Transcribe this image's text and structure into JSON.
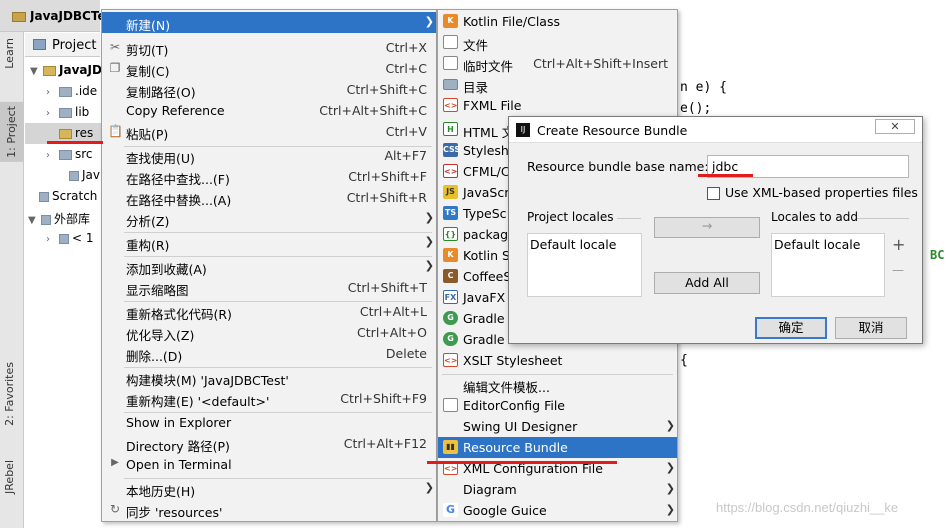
{
  "window": {
    "title": "JavaJDBCTe"
  },
  "left_tabs": [
    "Learn",
    "1: Project",
    "2: Favorites",
    "JRebel"
  ],
  "project_toolbar": {
    "label": "Project"
  },
  "project_tree": [
    {
      "label": "JavaJD",
      "arrow": "▼"
    },
    {
      "label": ".ide",
      "arrow": "›"
    },
    {
      "label": "lib",
      "arrow": "›"
    },
    {
      "label": "res",
      "arrow": ""
    },
    {
      "label": "src",
      "arrow": "›"
    },
    {
      "label": "Jav",
      "arrow": ""
    },
    {
      "label": "Scratch",
      "arrow": ""
    },
    {
      "label": "外部库",
      "arrow": "▼"
    },
    {
      "label": "< 1",
      "arrow": "›"
    }
  ],
  "editor": {
    "lines": [
      "n e) {",
      "e();",
      "{"
    ],
    "highlight_text": "BC"
  },
  "context_menu": {
    "items": [
      {
        "label": "新建(N)",
        "shortcut": "",
        "icon": "",
        "submenu": true,
        "highlighted": true
      },
      {
        "label": "剪切(T)",
        "shortcut": "Ctrl+X",
        "icon": "scissors-icon",
        "submenu": false
      },
      {
        "label": "复制(C)",
        "shortcut": "Ctrl+C",
        "icon": "copy-icon",
        "submenu": false
      },
      {
        "label": "复制路径(O)",
        "shortcut": "Ctrl+Shift+C",
        "icon": "",
        "submenu": false
      },
      {
        "label": "Copy Reference",
        "shortcut": "Ctrl+Alt+Shift+C",
        "icon": "",
        "submenu": false
      },
      {
        "label": "粘贴(P)",
        "shortcut": "Ctrl+V",
        "icon": "paste-icon",
        "submenu": false
      },
      {
        "label": "查找使用(U)",
        "shortcut": "Alt+F7",
        "icon": "",
        "submenu": false
      },
      {
        "label": "在路径中查找...(F)",
        "shortcut": "Ctrl+Shift+F",
        "icon": "",
        "submenu": false
      },
      {
        "label": "在路径中替换...(A)",
        "shortcut": "Ctrl+Shift+R",
        "icon": "",
        "submenu": false
      },
      {
        "label": "分析(Z)",
        "shortcut": "",
        "icon": "",
        "submenu": true
      },
      {
        "label": "重构(R)",
        "shortcut": "",
        "icon": "",
        "submenu": true
      },
      {
        "label": "添加到收藏(A)",
        "shortcut": "",
        "icon": "",
        "submenu": true
      },
      {
        "label": "显示缩略图",
        "shortcut": "Ctrl+Shift+T",
        "icon": "",
        "submenu": false
      },
      {
        "label": "重新格式化代码(R)",
        "shortcut": "Ctrl+Alt+L",
        "icon": "",
        "submenu": false
      },
      {
        "label": "优化导入(Z)",
        "shortcut": "Ctrl+Alt+O",
        "icon": "",
        "submenu": false
      },
      {
        "label": "删除...(D)",
        "shortcut": "Delete",
        "icon": "",
        "submenu": false
      },
      {
        "label": "构建模块(M) 'JavaJDBCTest'",
        "shortcut": "",
        "icon": "",
        "submenu": false
      },
      {
        "label": "重新构建(E) '<default>'",
        "shortcut": "Ctrl+Shift+F9",
        "icon": "",
        "submenu": false
      },
      {
        "label": "Show in Explorer",
        "shortcut": "",
        "icon": "",
        "submenu": false
      },
      {
        "label": "Directory 路径(P)",
        "shortcut": "Ctrl+Alt+F12",
        "icon": "",
        "submenu": false
      },
      {
        "label": "Open in Terminal",
        "shortcut": "",
        "icon": "terminal-icon",
        "submenu": false
      },
      {
        "label": "本地历史(H)",
        "shortcut": "",
        "icon": "",
        "submenu": true
      },
      {
        "label": "同步 'resources'",
        "shortcut": "",
        "icon": "sync-icon",
        "submenu": false
      }
    ]
  },
  "new_submenu": {
    "items": [
      {
        "label": "Kotlin File/Class",
        "shortcut": "",
        "icon": "kotlin-icon",
        "submenu": false
      },
      {
        "label": "文件",
        "shortcut": "",
        "icon": "file-icon",
        "submenu": false
      },
      {
        "label": "临时文件",
        "shortcut": "Ctrl+Alt+Shift+Insert",
        "icon": "scratch-file-icon",
        "submenu": false
      },
      {
        "label": "目录",
        "shortcut": "",
        "icon": "folder-icon",
        "submenu": false
      },
      {
        "label": "FXML File",
        "shortcut": "",
        "icon": "fxml-icon",
        "submenu": false
      },
      {
        "label": "HTML 文",
        "shortcut": "",
        "icon": "html-icon",
        "submenu": false
      },
      {
        "label": "Styleshe",
        "shortcut": "",
        "icon": "css-icon",
        "submenu": false
      },
      {
        "label": "CFML/C",
        "shortcut": "",
        "icon": "cfml-icon",
        "submenu": false
      },
      {
        "label": "JavaScr",
        "shortcut": "",
        "icon": "javascript-icon",
        "submenu": false
      },
      {
        "label": "TypeSc",
        "shortcut": "",
        "icon": "typescript-icon",
        "submenu": false
      },
      {
        "label": "packag",
        "shortcut": "",
        "icon": "package-json-icon",
        "submenu": false
      },
      {
        "label": "Kotlin S",
        "shortcut": "",
        "icon": "kotlin-script-icon",
        "submenu": false
      },
      {
        "label": "CoffeeS",
        "shortcut": "",
        "icon": "coffeescript-icon",
        "submenu": false
      },
      {
        "label": "JavaFX",
        "shortcut": "",
        "icon": "javafx-icon",
        "submenu": false
      },
      {
        "label": "Gradle",
        "shortcut": "",
        "icon": "gradle-icon",
        "submenu": false
      },
      {
        "label": "Gradle",
        "shortcut": "",
        "icon": "gradle-icon",
        "submenu": false
      },
      {
        "label": "XSLT Stylesheet",
        "shortcut": "",
        "icon": "xslt-icon",
        "submenu": false
      },
      {
        "label": "编辑文件模板...",
        "shortcut": "",
        "icon": "",
        "submenu": false
      },
      {
        "label": "EditorConfig File",
        "shortcut": "",
        "icon": "editorconfig-icon",
        "submenu": false
      },
      {
        "label": "Swing UI Designer",
        "shortcut": "",
        "icon": "",
        "submenu": true
      },
      {
        "label": "Resource Bundle",
        "shortcut": "",
        "icon": "resource-bundle-icon",
        "submenu": false,
        "highlighted": true
      },
      {
        "label": "XML Configuration File",
        "shortcut": "",
        "icon": "xml-icon",
        "submenu": true
      },
      {
        "label": "Diagram",
        "shortcut": "",
        "icon": "",
        "submenu": true
      },
      {
        "label": "Google Guice",
        "shortcut": "",
        "icon": "google-guice-icon",
        "submenu": true
      }
    ]
  },
  "dialog": {
    "title": "Create Resource Bundle",
    "close_label": "✕",
    "base_name_label": "Resource bundle base name:",
    "base_name_value": "jdbc",
    "xml_checkbox_label": "Use XML-based properties files",
    "project_locales_label": "Project locales",
    "locales_to_add_label": "Locales to add",
    "project_locales": [
      "Default locale"
    ],
    "locales_to_add": [
      "Default locale"
    ],
    "move_arrow": "→",
    "add_all_label": "Add All",
    "plus": "+",
    "minus": "—",
    "ok_label": "确定",
    "cancel_label": "取消"
  },
  "watermark": "https://blog.csdn.net/qiuzhi__ke",
  "colors": {
    "menu_highlight": "#2d74c7",
    "annotation_red": "#e21c1c"
  }
}
